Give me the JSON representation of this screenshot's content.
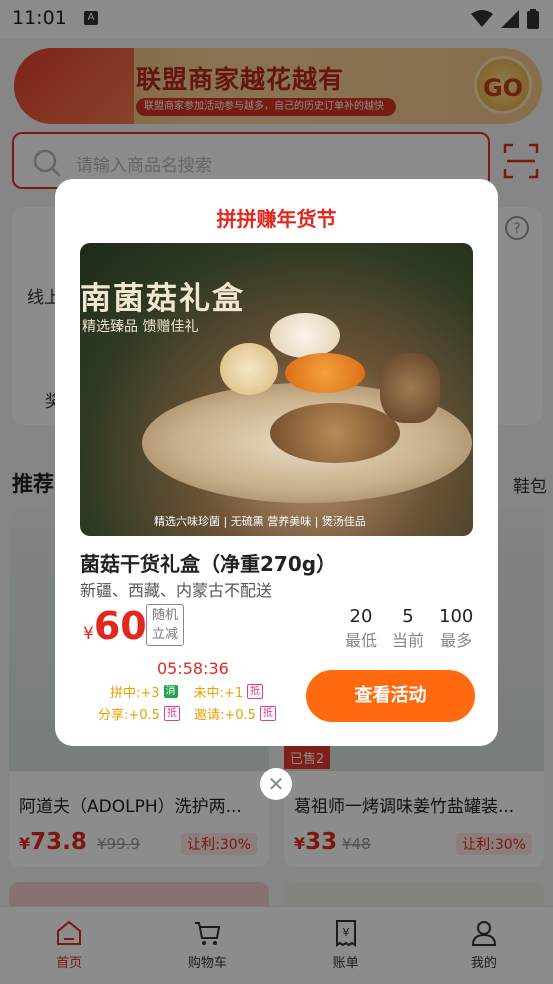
{
  "status": {
    "time": "11:01",
    "indicator": "A"
  },
  "banner": {
    "title": "联盟商家越花越有",
    "subtitle": "联盟商家参加活动参与越多，自己的历史订单补的越快",
    "go_label": "GO"
  },
  "search": {
    "placeholder": "请输入商品名搜索"
  },
  "categories": {
    "label_1": "线上",
    "label_2": "奖"
  },
  "recommend": {
    "title": "推荐",
    "right_text": "鞋包"
  },
  "products": [
    {
      "name": "阿道夫（ADOLPH）洗护两...",
      "currency": "¥",
      "price": "73.8",
      "original": "¥99.9",
      "badge": "让利:30%"
    },
    {
      "name": "葛祖师一烤调味姜竹盐罐装...",
      "currency": "¥",
      "price": "33",
      "original": "¥48",
      "badge": "让利:30%",
      "sold": "已售2"
    }
  ],
  "bottom_nav": [
    {
      "label": "首页",
      "icon": "home-icon",
      "active": true
    },
    {
      "label": "购物车",
      "icon": "cart-icon",
      "active": false
    },
    {
      "label": "账单",
      "icon": "bill-icon",
      "active": false
    },
    {
      "label": "我的",
      "icon": "profile-icon",
      "active": false
    }
  ],
  "modal": {
    "title": "拼拼赚年货节",
    "image": {
      "headline": "南菌菇礼盒",
      "tagline": "精选臻品 馈赠佳礼",
      "footer": "精选六味珍菌 | 无硫熏 营养美味 | 煲汤佳品"
    },
    "product_name": "菌菇干货礼盒（净重270g）",
    "shipping_note": "新疆、西藏、内蒙古不配送",
    "currency": "¥",
    "price": "60",
    "price_tag": [
      "随机",
      "立减"
    ],
    "stats": [
      {
        "value": "20",
        "label": "最低"
      },
      {
        "value": "5",
        "label": "当前"
      },
      {
        "value": "100",
        "label": "最多"
      }
    ],
    "countdown": "05:58:36",
    "rules": {
      "win": "拼中:+3",
      "win_chip": "消",
      "miss": "未中:+1",
      "miss_chip": "抵",
      "share": "分享:+0.5",
      "share_chip": "抵",
      "invite": "邀请:+0.5",
      "invite_chip": "抵"
    },
    "action_button": "查看活动",
    "close_symbol": "✕"
  },
  "colors": {
    "accent": "#e0281e",
    "button": "#ff6a10",
    "rule": "#e8a200"
  }
}
